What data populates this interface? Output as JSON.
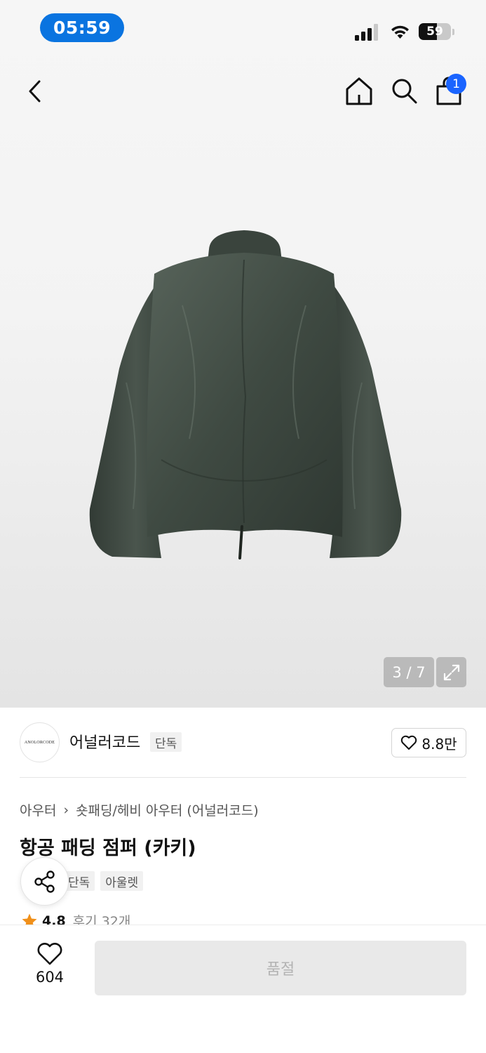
{
  "status_bar": {
    "time": "05:59",
    "battery": "59"
  },
  "header": {
    "cart_count": "1"
  },
  "gallery": {
    "pager": "3 / 7"
  },
  "brand": {
    "logo_text": "ANOLORCODE",
    "name": "어널러코드",
    "tag": "단독",
    "likes": "8.8만"
  },
  "product": {
    "breadcrumb": [
      "아우터",
      "숏패딩/헤비 아우터 (어널러코드)"
    ],
    "title": "항공 패딩 점퍼 (카키)",
    "tags": [
      "단독",
      "아울렛"
    ],
    "rating": "4.8",
    "reviews": "후기 32개"
  },
  "bottom_bar": {
    "wish_count": "604",
    "buy_label": "품절"
  },
  "colors": {
    "accent_blue": "#1a64ff",
    "time_pill": "#0a74e0",
    "star": "#f0901a",
    "jacket": "#3f4a42"
  },
  "icons": [
    "back-icon",
    "home-icon",
    "search-icon",
    "bag-icon",
    "expand-icon",
    "heart-icon",
    "share-icon",
    "star-icon"
  ]
}
